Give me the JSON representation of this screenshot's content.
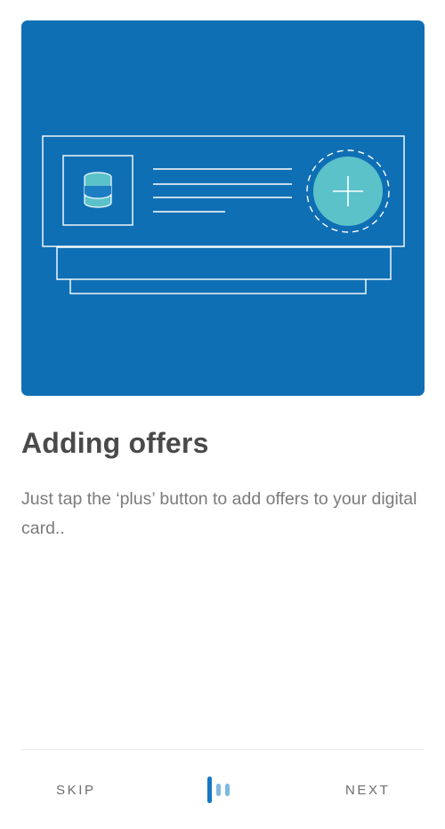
{
  "onboarding": {
    "title": "Adding offers",
    "description": "Just tap the ‘plus’ button to add offers to your digital card..",
    "illustration_icon": "plus-icon"
  },
  "footer": {
    "skip_label": "SKIP",
    "next_label": "NEXT",
    "pages_total": 3,
    "current_page": 1
  },
  "colors": {
    "illustration_bg": "#0f6fb5",
    "plus_circle": "#5cc2c9",
    "title_text": "#4a4a4a",
    "body_text": "#7b7b7b",
    "pager_active": "#1778c3",
    "pager_inactive": "#7fb8e2"
  }
}
